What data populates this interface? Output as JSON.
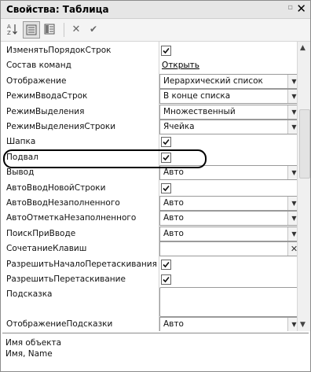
{
  "window": {
    "title": "Свойства: Таблица",
    "pin_icon": "pin-icon",
    "close_glyph": "✕"
  },
  "toolbar": {
    "icons": [
      "sort-az-icon",
      "categories-icon",
      "properties-icon",
      "delete-icon",
      "check-icon"
    ]
  },
  "rows": [
    {
      "label": "ИзменятьПорядокСтрок",
      "type": "checkbox",
      "checked": true
    },
    {
      "label": "Состав команд",
      "type": "link",
      "value": "Открыть"
    },
    {
      "label": "Отображение",
      "type": "dropdown",
      "value": "Иерархический список"
    },
    {
      "label": "РежимВводаСтрок",
      "type": "dropdown",
      "value": "В конце списка"
    },
    {
      "label": "РежимВыделения",
      "type": "dropdown",
      "value": "Множественный"
    },
    {
      "label": "РежимВыделенияСтроки",
      "type": "dropdown",
      "value": "Ячейка"
    },
    {
      "label": "Шапка",
      "type": "checkbox",
      "checked": true
    },
    {
      "label": "Подвал",
      "type": "checkbox",
      "checked": true
    },
    {
      "label": "Вывод",
      "type": "dropdown",
      "value": "Авто"
    },
    {
      "label": "АвтоВводНовойСтроки",
      "type": "checkbox",
      "checked": true
    },
    {
      "label": "АвтоВводНезаполненного",
      "type": "dropdown",
      "value": "Авто"
    },
    {
      "label": "АвтоОтметкаНезаполненного",
      "type": "dropdown",
      "value": "Авто"
    },
    {
      "label": "ПоискПриВводе",
      "type": "dropdown",
      "value": "Авто"
    },
    {
      "label": "СочетаниеКлавиш",
      "type": "clearfield",
      "value": ""
    },
    {
      "label": "РазрешитьНачалоПеретаскивания",
      "type": "checkbox",
      "checked": true
    },
    {
      "label": "РазрешитьПеретаскивание",
      "type": "checkbox",
      "checked": true
    },
    {
      "label": "Подсказка",
      "type": "textarea",
      "value": ""
    },
    {
      "label": "ОтображениеПодсказки",
      "type": "dropdown",
      "value": "Авто"
    }
  ],
  "status": {
    "line1": "Имя объекта",
    "line2": "Имя, Name"
  },
  "colors": {
    "highlight_outline": "#000000",
    "border": "#8c8c8c"
  }
}
